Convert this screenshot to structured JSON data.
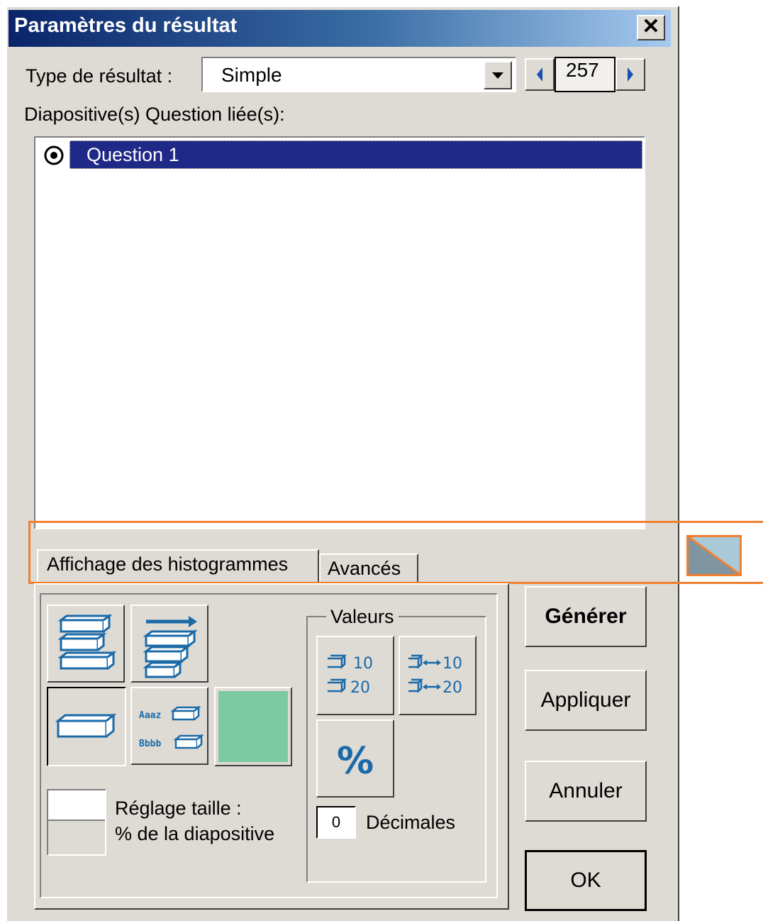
{
  "window": {
    "title": "Paramètres du résultat",
    "close_glyph": "✕"
  },
  "result_type": {
    "label": "Type de résultat :",
    "value": "Simple"
  },
  "stepper": {
    "value": "257"
  },
  "linked": {
    "label": "Diapositive(s) Question liée(s):",
    "items": [
      {
        "label": "Question  1",
        "selected": true
      }
    ]
  },
  "tabs": [
    {
      "label": "Affichage des histogrammes",
      "active": true
    },
    {
      "label": "Avancés",
      "active": false
    }
  ],
  "chart_options": {
    "label_sample_1": "Aaaz",
    "label_sample_2": "Bbbb",
    "color_swatch": "#7dc9a0"
  },
  "size": {
    "line1": "Réglage taille :",
    "line2": "% de la diapositive"
  },
  "values_group": {
    "title": "Valeurs",
    "n1": "10",
    "n2": "20",
    "n3": "10",
    "n4": "20",
    "percent": "%",
    "decimals_value": "0",
    "decimals_label": "Décimales"
  },
  "actions": {
    "generate": "Générer",
    "apply": "Appliquer",
    "cancel": "Annuler",
    "ok": "OK"
  },
  "colors": {
    "accent": "#f08030",
    "selection": "#1f2a88",
    "dialog": "#dedad4",
    "icon_blue": "#1a6aa8"
  }
}
